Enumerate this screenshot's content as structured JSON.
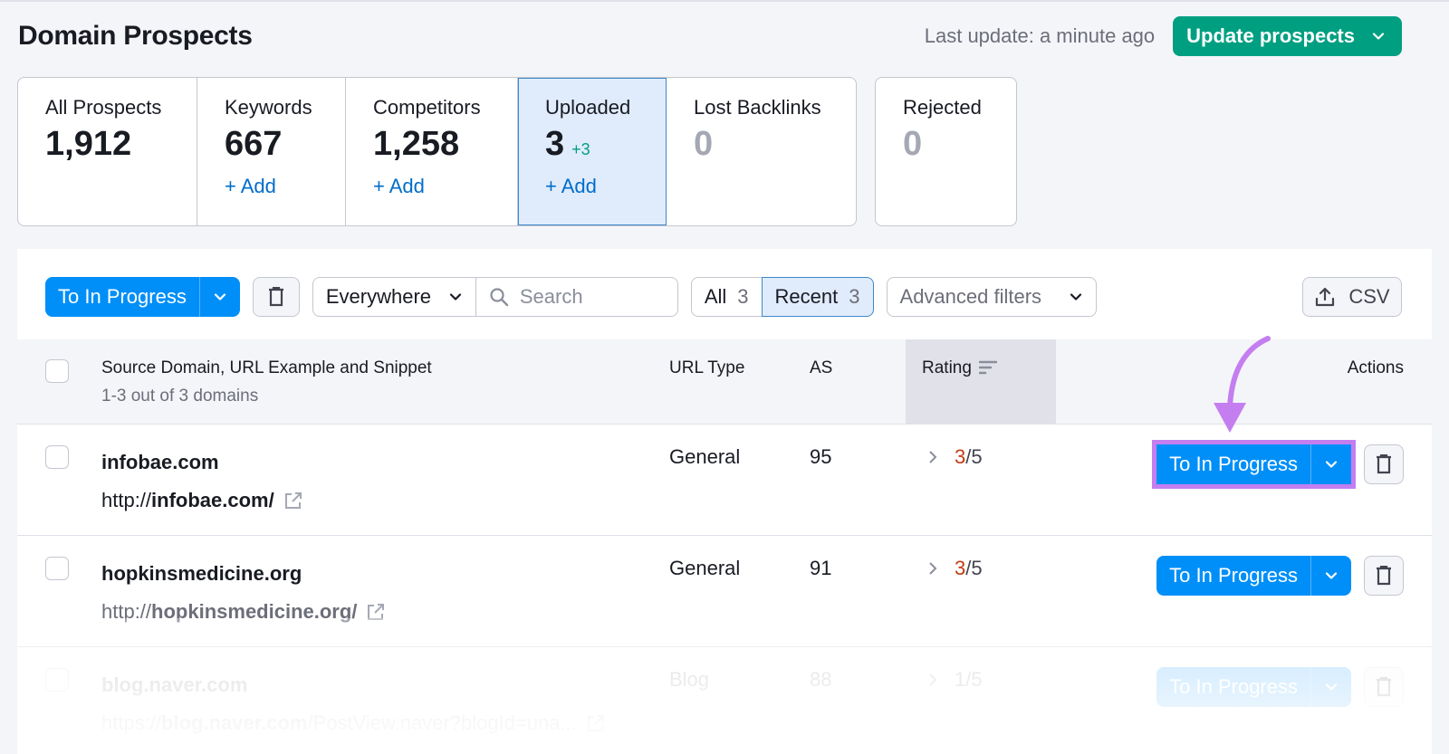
{
  "header": {
    "title": "Domain Prospects",
    "last_update": "Last update: a minute ago",
    "update_button": "Update prospects"
  },
  "cards": [
    {
      "label": "All Prospects",
      "value": "1,912",
      "add": null
    },
    {
      "label": "Keywords",
      "value": "667",
      "add": "+ Add"
    },
    {
      "label": "Competitors",
      "value": "1,258",
      "add": "+ Add"
    },
    {
      "label": "Uploaded",
      "value": "3",
      "delta": "+3",
      "add": "+ Add",
      "active": true
    },
    {
      "label": "Lost Backlinks",
      "value": "0",
      "add": null
    }
  ],
  "rejected_card": {
    "label": "Rejected",
    "value": "0"
  },
  "toolbar": {
    "bulk_action": "To In Progress",
    "scope_select": "Everywhere",
    "search_placeholder": "Search",
    "segments": [
      {
        "label": "All",
        "count": "3"
      },
      {
        "label": "Recent",
        "count": "3",
        "active": true
      }
    ],
    "advanced_filters": "Advanced filters",
    "export": "CSV"
  },
  "table": {
    "columns": {
      "source": "Source Domain, URL Example and Snippet",
      "source_sub": "1-3 out of 3 domains",
      "url_type": "URL Type",
      "as": "AS",
      "rating": "Rating",
      "actions": "Actions"
    },
    "rows": [
      {
        "domain": "infobae.com",
        "url_prefix": "http://",
        "url_bold": "infobae.com/",
        "url_suffix": "",
        "url_type": "General",
        "as": "95",
        "rating_value": "3",
        "rating_max": "/5",
        "action": "To In Progress",
        "highlighted": true
      },
      {
        "domain": "hopkinsmedicine.org",
        "url_prefix": "http://",
        "url_bold": "hopkinsmedicine.org/",
        "url_suffix": "",
        "url_type": "General",
        "as": "91",
        "rating_value": "3",
        "rating_max": "/5",
        "action": "To In Progress"
      },
      {
        "domain": "blog.naver.com",
        "url_prefix": "https://",
        "url_bold": "blog.naver.com",
        "url_suffix": "/PostView.naver?blogId=una...",
        "url_type": "Blog",
        "as": "88",
        "rating_value": "1",
        "rating_max": "/5",
        "action": "To In Progress"
      }
    ]
  },
  "colors": {
    "primary_blue": "#008ff8",
    "update_green": "#009f81",
    "rating_red": "#c23b12",
    "annotation_purple": "#c47ef0"
  }
}
